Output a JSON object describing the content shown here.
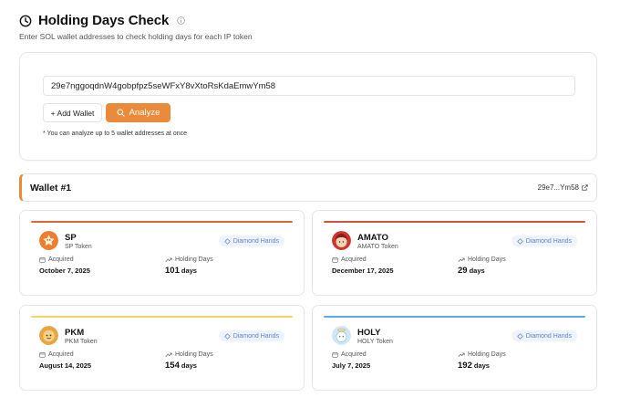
{
  "header": {
    "title": "Holding Days Check",
    "subtitle": "Enter SOL wallet addresses to check holding days for each IP token"
  },
  "input_panel": {
    "wallet_input_value": "29e7nggoqdnW4gobpfpz5seWFxY8vXtoRsKdaEmwYm58",
    "add_wallet_label": "+ Add Wallet",
    "analyze_label": "Analyze",
    "note": "* You can analyze up to 5 wallet addresses at once"
  },
  "wallet": {
    "title": "Wallet #1",
    "short_address": "29e7...Ym58"
  },
  "labels": {
    "acquired": "Acquired",
    "holding_days": "Holding Days",
    "days_unit": "days",
    "badge": "Diamond Hands"
  },
  "tokens": [
    {
      "symbol": "SP",
      "full_name": "SP Token",
      "acquired": "October 7, 2025",
      "holding_days": "101",
      "accent": "#d56a38"
    },
    {
      "symbol": "AMATO",
      "full_name": "AMATO Token",
      "acquired": "December 17, 2025",
      "holding_days": "29",
      "accent": "#cf5241"
    },
    {
      "symbol": "PKM",
      "full_name": "PKM Token",
      "acquired": "August 14, 2025",
      "holding_days": "154",
      "accent": "#f1d46a"
    },
    {
      "symbol": "HOLY",
      "full_name": "HOLY Token",
      "acquired": "July 7, 2025",
      "holding_days": "192",
      "accent": "#5aaee8"
    }
  ],
  "colors": {
    "brand_orange": "#e98b3b",
    "badge_bg": "#eef3fb",
    "badge_text": "#5b87c7"
  }
}
